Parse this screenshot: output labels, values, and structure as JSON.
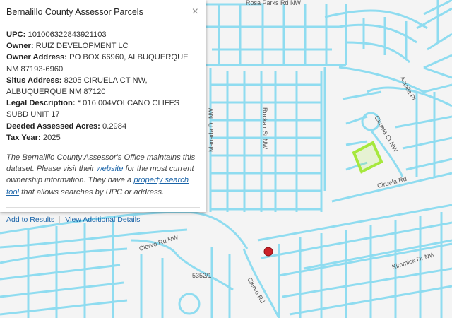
{
  "popup": {
    "title": "Bernalillo County Assessor Parcels",
    "close_symbol": "×",
    "attributes": [
      {
        "label": "UPC:",
        "value": "101006322843921103"
      },
      {
        "label": "Owner:",
        "value": "RUIZ DEVELOPMENT LC"
      },
      {
        "label": "Owner Address:",
        "value": "PO BOX 66960, ALBUQUERQUE NM 87193-6960"
      },
      {
        "label": "Situs Address:",
        "value": "8205 CIRUELA CT NW, ALBUQUERQUE NM 87120"
      },
      {
        "label": "Legal Description:",
        "value": "* 016 004VOLCANO CLIFFS SUBD UNIT 17"
      },
      {
        "label": "Deeded Assessed Acres:",
        "value": "0.2984"
      },
      {
        "label": "Tax Year:",
        "value": "2025"
      }
    ],
    "description": {
      "part1": "The Bernalillo County Assessor's Office maintains this dataset. Please visit their ",
      "website_link": "website",
      "part2": " for the most current ownership information. They have a ",
      "search_link": "property search tool",
      "part3": " that allows searches by UPC or address."
    },
    "actions": {
      "add_to_results": "Add to Results",
      "view_details": "View Additional Details"
    }
  },
  "map": {
    "street_labels": {
      "rosa_parks": "Rosa Parks Rd NW",
      "acuilla": "Acuilla Pl",
      "manada": "Manada Dr NW",
      "rockaire": "Rockair St NW",
      "ciruela_ct": "Ciruela Ct NW",
      "ciruela_rd": "Ciruela Rd",
      "ciervo_rd_nw": "Ciervo Rd NW",
      "ciervo_rd": "Ciervo Rd",
      "kimmick": "Kimmick Dr NW",
      "parcel_5352": "5352/1"
    },
    "colors": {
      "background": "#f4f4f4",
      "parcel_outline": "#8fdcf0",
      "selected_parcel": "#a6e83c",
      "marker": "#cc1f26"
    },
    "marker_icon": "red-dot-marker-icon"
  }
}
